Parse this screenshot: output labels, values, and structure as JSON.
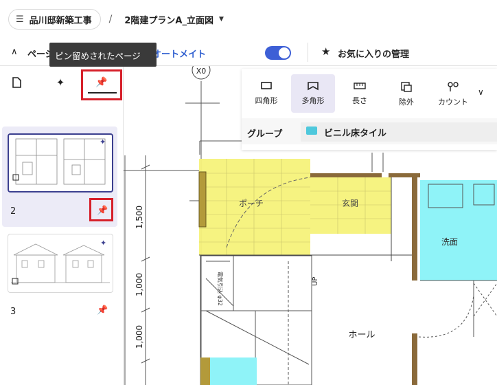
{
  "header": {
    "project_name": "品川邸新築工事",
    "separator": "/",
    "drawing_name": "2階建プランA_立面図"
  },
  "subbar": {
    "pages_label": "ページ",
    "auto_label": "オートメイト",
    "favorites_label": "お気に入りの管理",
    "toggle_on": true,
    "accent_color": "#3d5fd6"
  },
  "tooltip": {
    "text": "ピン留めされたページ"
  },
  "panel": {
    "tabs": [
      {
        "icon": "page-icon"
      },
      {
        "icon": "sparkle-icon"
      },
      {
        "icon": "pin-icon"
      }
    ],
    "pages": [
      {
        "number": "2",
        "selected": true,
        "pinned": true
      },
      {
        "number": "3",
        "selected": false,
        "pinned": true
      }
    ]
  },
  "tools": {
    "items": [
      {
        "label": "四角形",
        "icon": "rectangle-icon"
      },
      {
        "label": "多角形",
        "icon": "polygon-icon"
      },
      {
        "label": "長さ",
        "icon": "ruler-icon"
      },
      {
        "label": "除外",
        "icon": "exclude-icon"
      },
      {
        "label": "カウント",
        "icon": "count-icon"
      }
    ],
    "active": "多角形",
    "group_label": "グループ",
    "group_value": "ビニル床タイル"
  },
  "drawing": {
    "grid_label": "X0",
    "dims": [
      "1,500",
      "1,000",
      "1,000"
    ],
    "rooms": [
      "ポーチ",
      "玄関",
      "洗面",
      "ホール"
    ],
    "stair_label": "UP",
    "stair_note": "電気引込 φ32",
    "highlight_colors": {
      "yellow": "#f6f27a",
      "cyan": "#8ff3f8"
    }
  }
}
